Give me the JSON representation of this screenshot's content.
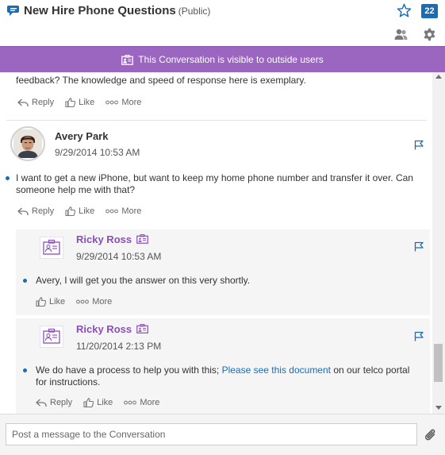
{
  "header": {
    "title": "New Hire Phone Questions",
    "visibility": "(Public)",
    "count_badge": "22",
    "icons": [
      "conversation-icon",
      "star-icon",
      "people-icon",
      "gear-icon"
    ]
  },
  "banner": {
    "text": "This Conversation is visible to outside users",
    "color": "#9b66bf",
    "icon": "external-user-badge-icon"
  },
  "feed": {
    "partial_message": {
      "text": "feedback? The knowledge and speed of response here is exemplary.",
      "actions": {
        "reply": "Reply",
        "like": "Like",
        "more": "More"
      }
    },
    "messages": [
      {
        "author": "Avery Park",
        "timestamp": "9/29/2014 10:53 AM",
        "body_line1": "I want to get a new iPhone, but want to keep my home phone number and transfer it over.  Can",
        "body_line2": "someone help me with that?",
        "actions": {
          "reply": "Reply",
          "like": "Like",
          "more": "More"
        },
        "replies": [
          {
            "author": "Ricky Ross",
            "timestamp": "9/29/2014 10:53 AM",
            "body": "Avery, I will get you the answer on this very shortly.",
            "actions": {
              "like": "Like",
              "more": "More"
            }
          },
          {
            "author": "Ricky Ross",
            "timestamp": "11/20/2014 2:13 PM",
            "body_pre": "We do have a process to help you with this; ",
            "body_link": "Please see this document",
            "body_post": " on our telco portal",
            "body_line2": "for instructions.",
            "actions": {
              "reply": "Reply",
              "like": "Like",
              "more": "More"
            }
          }
        ]
      }
    ]
  },
  "composer": {
    "placeholder": "Post a message to the Conversation"
  },
  "colors": {
    "accent_blue": "#1a6cb5",
    "external_purple": "#8a4fb8",
    "banner_purple": "#9b66bf"
  }
}
